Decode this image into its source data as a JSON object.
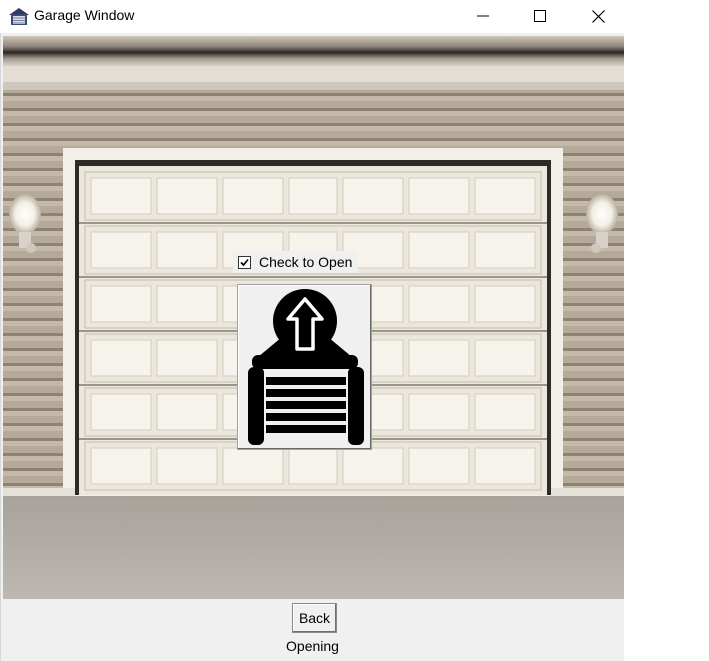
{
  "window": {
    "title": "Garage Window",
    "icons": {
      "app": "garage-icon",
      "minimize": "minimize-icon",
      "maximize": "maximize-icon",
      "close": "close-icon"
    }
  },
  "garage": {
    "checkbox_label": "Check to Open",
    "checkbox_checked": true,
    "door_button_icon": "garage-open-arrow-icon"
  },
  "controls": {
    "back_label": "Back",
    "status": "Opening"
  }
}
